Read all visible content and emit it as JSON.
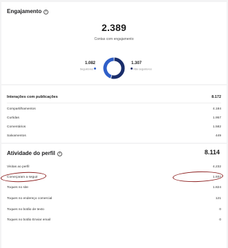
{
  "engagement": {
    "title": "Engajamento",
    "total": "2.389",
    "subtitle": "Contas com engajamento",
    "followers": {
      "value": "1.082",
      "label": "Seguidores"
    },
    "non_followers": {
      "value": "1.307",
      "label": "Não seguidores"
    },
    "followers_fraction": 0.453,
    "colors": {
      "followers": "#2f5fc9",
      "non_followers": "#1a2e6b"
    }
  },
  "interactions": {
    "header": {
      "label": "Interações com publicações",
      "value": "8.172"
    },
    "rows": [
      {
        "label": "Compartilhamentos",
        "value": "4.184"
      },
      {
        "label": "Curtidas",
        "value": "1.957"
      },
      {
        "label": "Comentários",
        "value": "1.582"
      },
      {
        "label": "Salvamentos",
        "value": "449"
      }
    ]
  },
  "profile_activity": {
    "title": "Atividade do perfil",
    "total": "8.114",
    "rows": [
      {
        "label": "Visitas ao perfil",
        "value": "4.232"
      },
      {
        "label": "Começaram a seguir",
        "value": "1.937"
      },
      {
        "label": "Toques no site",
        "value": "1.824"
      },
      {
        "label": "Toques no endereço comercial",
        "value": "121"
      },
      {
        "label": "Toques no botão de texto",
        "value": "0"
      },
      {
        "label": "Toques no botão Enviar email",
        "value": "0"
      }
    ]
  }
}
